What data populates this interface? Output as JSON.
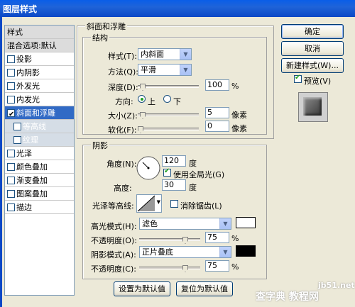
{
  "window": {
    "title": "图层样式"
  },
  "sidebar": {
    "header": "样式",
    "items": [
      {
        "label": "混合选项:默认",
        "checkbox": false,
        "checked": false
      },
      {
        "label": "投影",
        "checkbox": true,
        "checked": false
      },
      {
        "label": "内阴影",
        "checkbox": true,
        "checked": false
      },
      {
        "label": "外发光",
        "checkbox": true,
        "checked": false
      },
      {
        "label": "内发光",
        "checkbox": true,
        "checked": false
      },
      {
        "label": "斜面和浮雕",
        "checkbox": true,
        "checked": true
      },
      {
        "label": "等高线",
        "checkbox": true,
        "checked": false
      },
      {
        "label": "纹理",
        "checkbox": true,
        "checked": false
      },
      {
        "label": "光泽",
        "checkbox": true,
        "checked": false
      },
      {
        "label": "颜色叠加",
        "checkbox": true,
        "checked": false
      },
      {
        "label": "渐变叠加",
        "checkbox": true,
        "checked": false
      },
      {
        "label": "图案叠加",
        "checkbox": true,
        "checked": false
      },
      {
        "label": "描边",
        "checkbox": true,
        "checked": false
      }
    ]
  },
  "bevel": {
    "section_title": "斜面和浮雕",
    "structure": {
      "title": "结构",
      "style_label": "样式(T):",
      "style_value": "内斜面",
      "technique_label": "方法(Q):",
      "technique_value": "平滑",
      "depth_label": "深度(D):",
      "depth_value": "100",
      "depth_unit": "%",
      "direction_label": "方向:",
      "direction_up": "上",
      "direction_down": "下",
      "size_label": "大小(Z):",
      "size_value": "5",
      "size_unit": "像素",
      "soften_label": "软化(F):",
      "soften_value": "0",
      "soften_unit": "像素"
    },
    "shading": {
      "title": "阴影",
      "angle_label": "角度(N):",
      "angle_value": "120",
      "angle_unit": "度",
      "global_light_label": "使用全局光(G)",
      "altitude_label": "高度:",
      "altitude_value": "30",
      "altitude_unit": "度",
      "gloss_contour_label": "光泽等高线:",
      "antialias_label": "消除锯齿(L)",
      "highlight_mode_label": "高光模式(H):",
      "highlight_mode_value": "滤色",
      "highlight_color": "#ffffff",
      "highlight_opacity_label": "不透明度(O):",
      "highlight_opacity_value": "75",
      "highlight_opacity_unit": "%",
      "shadow_mode_label": "阴影模式(A):",
      "shadow_mode_value": "正片叠底",
      "shadow_color": "#000000",
      "shadow_opacity_label": "不透明度(C):",
      "shadow_opacity_value": "75",
      "shadow_opacity_unit": "%"
    },
    "set_default_label": "设置为默认值",
    "reset_default_label": "复位为默认值"
  },
  "buttons": {
    "ok": "确定",
    "cancel": "取消",
    "new_style": "新建样式(W)...",
    "preview": "预览(V)"
  },
  "watermark": {
    "site": "jb51.net",
    "brand": "查字典 教程网"
  }
}
